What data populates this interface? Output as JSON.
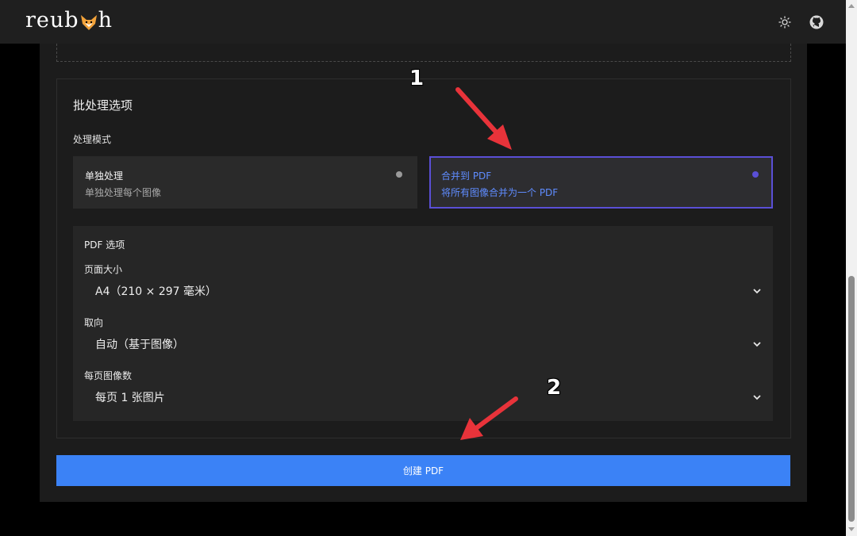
{
  "header": {
    "logo_text_left": "reub",
    "logo_text_right": "h",
    "theme_icon": "sun-icon",
    "github_icon": "github-icon"
  },
  "batch": {
    "title": "批处理选项",
    "mode_label": "处理模式",
    "modes": [
      {
        "title": "单独处理",
        "desc": "单独处理每个图像",
        "selected": false
      },
      {
        "title": "合并到 PDF",
        "desc": "将所有图像合并为一个 PDF",
        "selected": true
      }
    ]
  },
  "pdf_options": {
    "heading": "PDF 选项",
    "page_size_label": "页面大小",
    "page_size_value": "A4（210 × 297 毫米）",
    "orientation_label": "取向",
    "orientation_value": "自动（基于图像）",
    "per_page_label": "每页图像数",
    "per_page_value": "每页 1 张图片"
  },
  "actions": {
    "create_label": "创建 PDF"
  },
  "annotations": {
    "num1": "1",
    "num2": "2"
  },
  "colors": {
    "accent": "#3b82f6",
    "selected_border": "#5a4fd6",
    "selected_text": "#5f8cff",
    "annotation_arrow": "#e8333a"
  }
}
